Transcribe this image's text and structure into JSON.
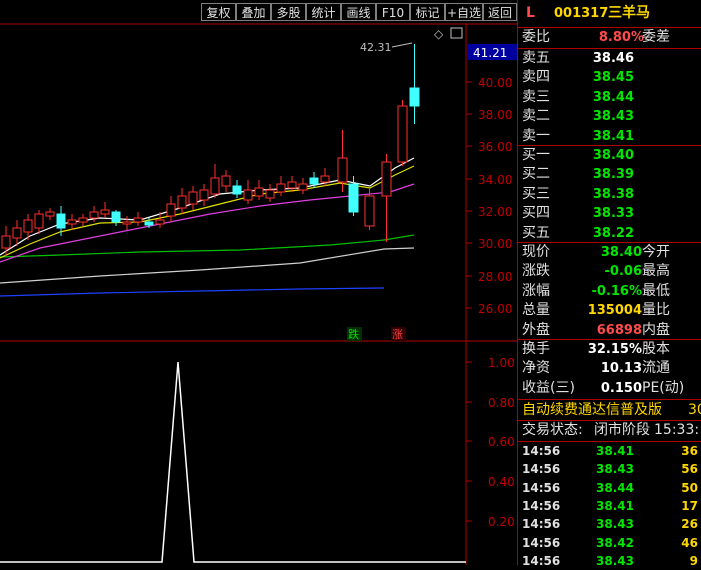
{
  "toolbar": {
    "buttons": [
      "复权",
      "叠加",
      "多股",
      "统计",
      "画线",
      "F10",
      "标记",
      "+自选",
      "返回"
    ]
  },
  "chart": {
    "price_axis": [
      "41.21",
      "40.00",
      "38.00",
      "36.00",
      "34.00",
      "32.00",
      "30.00",
      "28.00",
      "26.00"
    ],
    "high_marker": "42.31",
    "lower_axis": [
      "1.00",
      "0.80",
      "0.60",
      "0.40",
      "0.20"
    ],
    "down_label": "跌",
    "up_label": "涨",
    "pointer_icon": "diamond-icon",
    "box_icon": "window-icon"
  },
  "quote": {
    "marker": "L",
    "code": "001317",
    "name": "三羊马",
    "weibi_label": "委比",
    "weibi_value": "8.80%",
    "weicha_label": "委差",
    "asks": [
      {
        "label": "卖五",
        "price": "38.46"
      },
      {
        "label": "卖四",
        "price": "38.45"
      },
      {
        "label": "卖三",
        "price": "38.44"
      },
      {
        "label": "卖二",
        "price": "38.43"
      },
      {
        "label": "卖一",
        "price": "38.41"
      }
    ],
    "bids": [
      {
        "label": "买一",
        "price": "38.40"
      },
      {
        "label": "买二",
        "price": "38.39"
      },
      {
        "label": "买三",
        "price": "38.38"
      },
      {
        "label": "买四",
        "price": "38.33"
      },
      {
        "label": "买五",
        "price": "38.22"
      }
    ],
    "stats": [
      {
        "label": "现价",
        "value": "38.40",
        "right": "今开"
      },
      {
        "label": "涨跌",
        "value": "-0.06",
        "right": "最高"
      },
      {
        "label": "涨幅",
        "value": "-0.16%",
        "right": "最低"
      },
      {
        "label": "总量",
        "value": "135004",
        "right": "量比"
      },
      {
        "label": "外盘",
        "value": "66898",
        "right": "内盘"
      }
    ],
    "finance": [
      {
        "label": "换手",
        "value": "32.15%",
        "right": "股本"
      },
      {
        "label": "净资",
        "value": "10.13",
        "right": "流通"
      },
      {
        "label": "收益(三)",
        "value": "0.150",
        "right": "PE(动)"
      }
    ],
    "notice": "自动续费通达信普及版",
    "notice_tail": "30",
    "status_label": "交易状态:",
    "status_value": "闭市阶段",
    "status_time": "15:33:",
    "ticks": [
      {
        "time": "14:56",
        "price": "38.41",
        "vol": "36"
      },
      {
        "time": "14:56",
        "price": "38.43",
        "vol": "56"
      },
      {
        "time": "14:56",
        "price": "38.44",
        "vol": "50"
      },
      {
        "time": "14:56",
        "price": "38.41",
        "vol": "17"
      },
      {
        "time": "14:56",
        "price": "38.43",
        "vol": "26"
      },
      {
        "time": "14:56",
        "price": "38.42",
        "vol": "46"
      },
      {
        "time": "14:56",
        "price": "38.43",
        "vol": "9"
      }
    ]
  }
}
